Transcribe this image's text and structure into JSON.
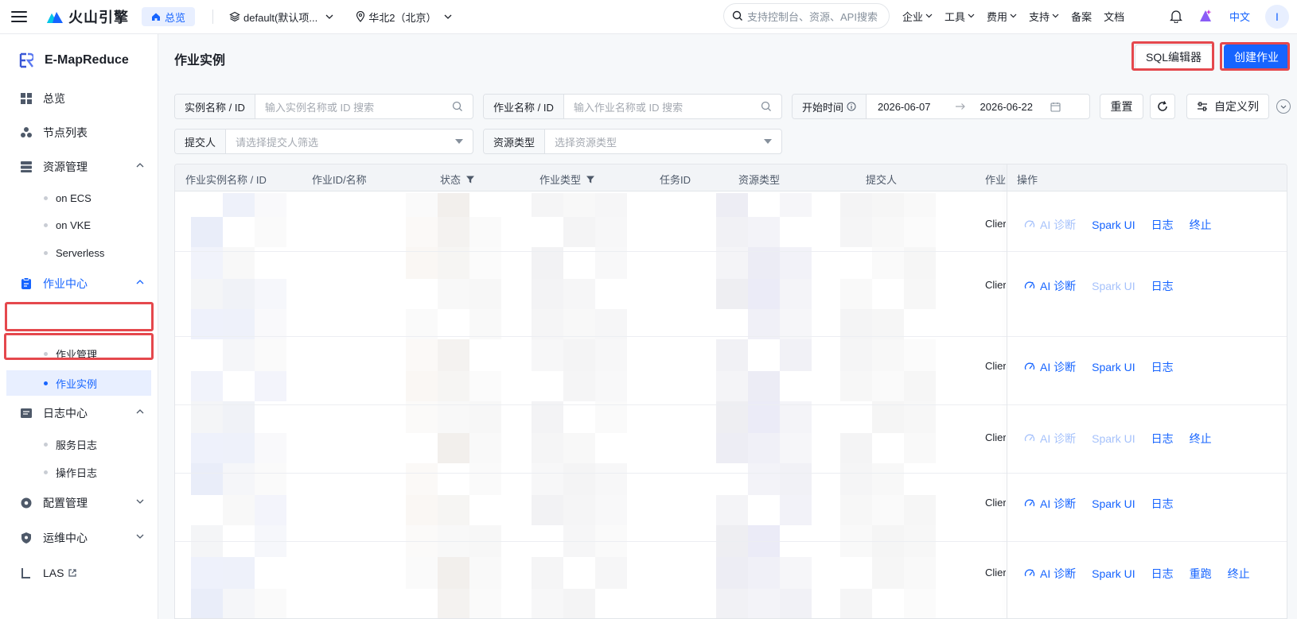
{
  "topbar": {
    "brand": "火山引擎",
    "home_label": "总览",
    "project": "default(默认项...",
    "region": "华北2（北京）",
    "search_placeholder": "支持控制台、资源、API搜索",
    "nav": [
      "企业",
      "工具",
      "费用",
      "支持",
      "备案",
      "文档"
    ],
    "lang": "中文",
    "avatar": "I"
  },
  "sidebar": {
    "title": "E-MapReduce",
    "items": [
      {
        "label": "总览",
        "icon": "grid-icon"
      },
      {
        "label": "节点列表",
        "icon": "nodes-icon"
      },
      {
        "label": "资源管理",
        "icon": "stack-icon",
        "expanded": true,
        "children": [
          "on ECS",
          "on VKE",
          "Serverless"
        ]
      },
      {
        "label": "作业中心",
        "icon": "clipboard-icon",
        "expanded": true,
        "active": true,
        "children": [
          "作业管理",
          "作业实例"
        ]
      },
      {
        "label": "日志中心",
        "icon": "log-icon",
        "expanded": true,
        "children": [
          "服务日志",
          "操作日志"
        ]
      },
      {
        "label": "配置管理",
        "icon": "gear-icon",
        "expanded": false
      },
      {
        "label": "运维中心",
        "icon": "shield-icon",
        "expanded": false
      },
      {
        "label": "LAS",
        "icon": "external-link-icon"
      }
    ],
    "current": "作业实例"
  },
  "page": {
    "title": "作业实例",
    "sql_editor": "SQL编辑器",
    "create_job": "创建作业"
  },
  "filters": {
    "instance_label": "实例名称 / ID",
    "instance_placeholder": "输入实例名称或 ID 搜索",
    "job_label": "作业名称 / ID",
    "job_placeholder": "输入作业名称或 ID 搜索",
    "start_label": "开始时间",
    "date_from": "2026-06-07",
    "date_to": "2026-06-22",
    "reset": "重置",
    "custom_columns": "自定义列",
    "submitter_label": "提交人",
    "submitter_placeholder": "请选择提交人筛选",
    "resource_label": "资源类型",
    "resource_placeholder": "选择资源类型"
  },
  "table": {
    "columns": [
      "作业实例名称 / ID",
      "作业ID/名称",
      "状态",
      "作业类型",
      "任务ID",
      "资源类型",
      "提交人",
      "作业",
      "操作"
    ],
    "rows": [
      {
        "type": "Clier",
        "ops": [
          {
            "label": "AI 诊断",
            "enabled": false
          },
          {
            "label": "Spark UI",
            "enabled": true
          },
          {
            "label": "日志",
            "enabled": true
          },
          {
            "label": "终止",
            "enabled": true
          }
        ]
      },
      {
        "type": "Clier",
        "ops": [
          {
            "label": "AI 诊断",
            "enabled": true
          },
          {
            "label": "Spark UI",
            "enabled": false
          },
          {
            "label": "日志",
            "enabled": true
          }
        ]
      },
      {
        "type": "Clier",
        "ops": [
          {
            "label": "AI 诊断",
            "enabled": true
          },
          {
            "label": "Spark UI",
            "enabled": true
          },
          {
            "label": "日志",
            "enabled": true
          }
        ]
      },
      {
        "type": "Clier",
        "ops": [
          {
            "label": "AI 诊断",
            "enabled": false
          },
          {
            "label": "Spark UI",
            "enabled": false
          },
          {
            "label": "日志",
            "enabled": true
          },
          {
            "label": "终止",
            "enabled": true
          }
        ]
      },
      {
        "type": "Clier",
        "ops": [
          {
            "label": "AI 诊断",
            "enabled": true
          },
          {
            "label": "Spark UI",
            "enabled": true
          },
          {
            "label": "日志",
            "enabled": true
          }
        ]
      },
      {
        "type": "Clier",
        "ops": [
          {
            "label": "AI 诊断",
            "enabled": true
          },
          {
            "label": "Spark UI",
            "enabled": true
          },
          {
            "label": "日志",
            "enabled": true
          },
          {
            "label": "重跑",
            "enabled": true
          },
          {
            "label": "终止",
            "enabled": true
          }
        ]
      }
    ]
  },
  "colors": {
    "accent": "#1664ff",
    "highlight": "#e5484d"
  }
}
